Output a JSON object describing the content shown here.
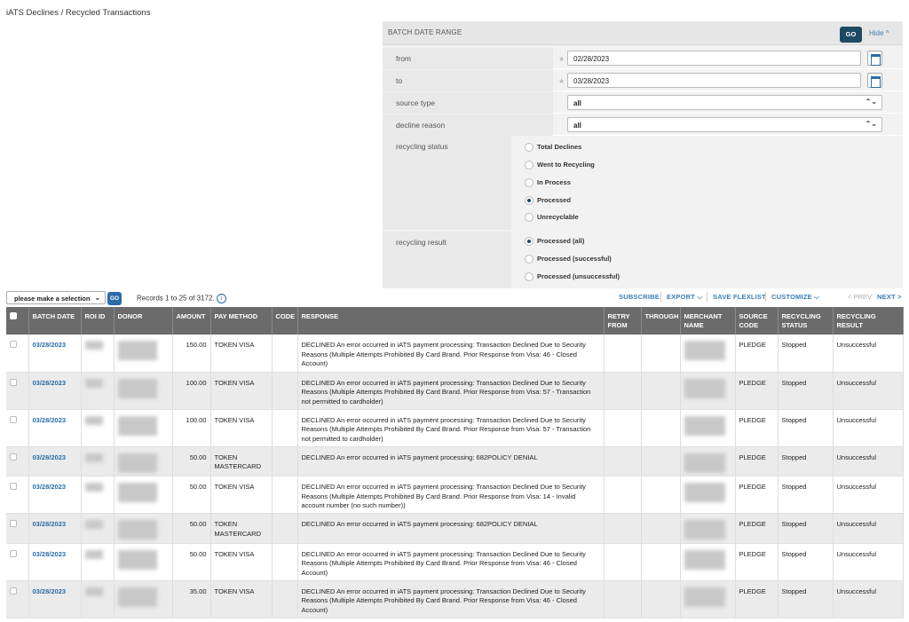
{
  "page": {
    "title": "iATS Declines / Recycled Transactions"
  },
  "filter": {
    "header": "BATCH DATE RANGE",
    "go_label": "GO",
    "hide_label": "Hide ^",
    "from_label": "from",
    "from_value": "02/28/2023",
    "to_label": "to",
    "to_value": "03/28/2023",
    "source_type_label": "source type",
    "source_type_value": "all",
    "decline_reason_label": "decline reason",
    "decline_reason_value": "all",
    "recycling_status_label": "recycling status",
    "recycling_status_options": [
      {
        "label": "Total Declines",
        "selected": false
      },
      {
        "label": "Went to Recycling",
        "selected": false
      },
      {
        "label": "In Process",
        "selected": false
      },
      {
        "label": "Processed",
        "selected": true
      },
      {
        "label": "Unrecyclable",
        "selected": false
      }
    ],
    "recycling_result_label": "recycling result",
    "recycling_result_options": [
      {
        "label": "Processed (all)",
        "selected": true
      },
      {
        "label": "Processed (successful)",
        "selected": false
      },
      {
        "label": "Processed (unsuccessful)",
        "selected": false
      }
    ]
  },
  "toolbar": {
    "select_value": "please make a selection",
    "go_label": "GO",
    "records_text": "Records 1 to 25 of 3172.",
    "info_icon": "i",
    "subscribe": "SUBSCRIBE",
    "export": "EXPORT ⌵",
    "save_flexlist": "SAVE FLEXLIST",
    "customize": "CUSTOMIZE ⌵",
    "prev": "< PREV",
    "next": "NEXT >"
  },
  "table": {
    "headers": [
      "BATCH DATE",
      "ROI ID",
      "DONOR",
      "AMOUNT",
      "PAY METHOD",
      "CODE",
      "RESPONSE",
      "RETRY FROM",
      "THROUGH",
      "MERCHANT NAME",
      "SOURCE CODE",
      "RECYCLING STATUS",
      "RECYCLING RESULT"
    ],
    "rows": [
      {
        "date": "03/28/2023",
        "amount": "150.00",
        "pay": "TOKEN VISA",
        "response": "DECLINED An error occurred in iATS payment processing: Transaction Declined Due to Security Reasons (Multiple Attempts Prohibited By Card Brand. Prior Response from Visa: 46 - Closed Account)",
        "source": "PLEDGE",
        "status": "Stopped",
        "result": "Unsuccessful"
      },
      {
        "date": "03/28/2023",
        "amount": "100.00",
        "pay": "TOKEN VISA",
        "response": "DECLINED An error occurred in iATS payment processing: Transaction Declined Due to Security Reasons (Multiple Attempts Prohibited By Card Brand. Prior Response from Visa: 57 - Transaction not permitted to cardholder)",
        "source": "PLEDGE",
        "status": "Stopped",
        "result": "Unsuccessful"
      },
      {
        "date": "03/28/2023",
        "amount": "100.00",
        "pay": "TOKEN VISA",
        "response": "DECLINED An error occurred in iATS payment processing: Transaction Declined Due to Security Reasons (Multiple Attempts Prohibited By Card Brand. Prior Response from Visa: 57 - Transaction not permitted to cardholder)",
        "source": "PLEDGE",
        "status": "Stopped",
        "result": "Unsuccessful"
      },
      {
        "date": "03/28/2023",
        "amount": "50.00",
        "pay": "TOKEN MASTERCARD",
        "response": "DECLINED An error occurred in iATS payment processing: 682POLICY DENIAL",
        "source": "PLEDGE",
        "status": "Stopped",
        "result": "Unsuccessful"
      },
      {
        "date": "03/28/2023",
        "amount": "50.00",
        "pay": "TOKEN VISA",
        "response": "DECLINED An error occurred in iATS payment processing: Transaction Declined Due to Security Reasons (Multiple Attempts Prohibited By Card Brand. Prior Response from Visa: 14 - Invalid account number (no such number))",
        "source": "PLEDGE",
        "status": "Stopped",
        "result": "Unsuccessful"
      },
      {
        "date": "03/28/2023",
        "amount": "50.00",
        "pay": "TOKEN MASTERCARD",
        "response": "DECLINED An error occurred in iATS payment processing: 682POLICY DENIAL",
        "source": "PLEDGE",
        "status": "Stopped",
        "result": "Unsuccessful"
      },
      {
        "date": "03/28/2023",
        "amount": "50.00",
        "pay": "TOKEN VISA",
        "response": "DECLINED An error occurred in iATS payment processing: Transaction Declined Due to Security Reasons (Multiple Attempts Prohibited By Card Brand. Prior Response from Visa: 46 - Closed Account)",
        "source": "PLEDGE",
        "status": "Stopped",
        "result": "Unsuccessful"
      },
      {
        "date": "03/28/2023",
        "amount": "35.00",
        "pay": "TOKEN VISA",
        "response": "DECLINED An error occurred in iATS payment processing: Transaction Declined Due to Security Reasons (Multiple Attempts Prohibited By Card Brand. Prior Response from Visa: 46 - Closed Account)",
        "source": "PLEDGE",
        "status": "Stopped",
        "result": "Unsuccessful"
      }
    ]
  },
  "colors": {
    "accent": "#1d4a63",
    "link": "#2a6da8",
    "header_bg": "#6b6b6b"
  }
}
